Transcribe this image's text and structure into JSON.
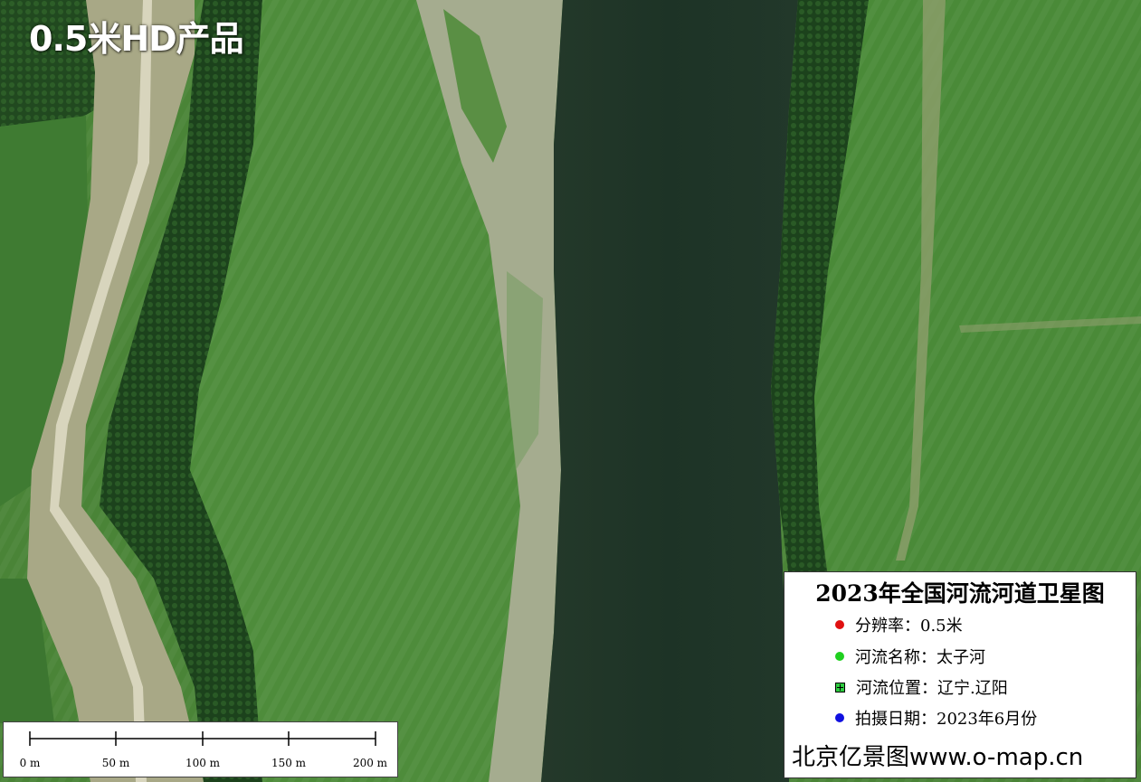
{
  "image_title": "0.5米HD产品",
  "map": {
    "colors": {
      "river": "#1f3427",
      "field": "#4f8b3a",
      "forest": "#1f4a1f",
      "levee": "#a7a887",
      "sandbank": "#a7ae93"
    }
  },
  "scale_bar": {
    "ticks": [
      "0 m",
      "50 m",
      "100 m",
      "150 m",
      "200 m"
    ]
  },
  "legend": {
    "title": "2023年全国河流河道卫星图",
    "items": [
      {
        "symbol": "red-dot-icon",
        "color": "#e01010",
        "label": "分辨率：0.5米"
      },
      {
        "symbol": "green-dot-icon",
        "color": "#1fd01f",
        "label": "河流名称：太子河"
      },
      {
        "symbol": "green-square-icon",
        "color": "#2ecc40",
        "label": "河流位置：辽宁.辽阳"
      },
      {
        "symbol": "blue-dot-icon",
        "color": "#1010e0",
        "label": "拍摄日期：2023年6月份"
      }
    ],
    "footer": "北京亿景图www.o-map.cn"
  }
}
